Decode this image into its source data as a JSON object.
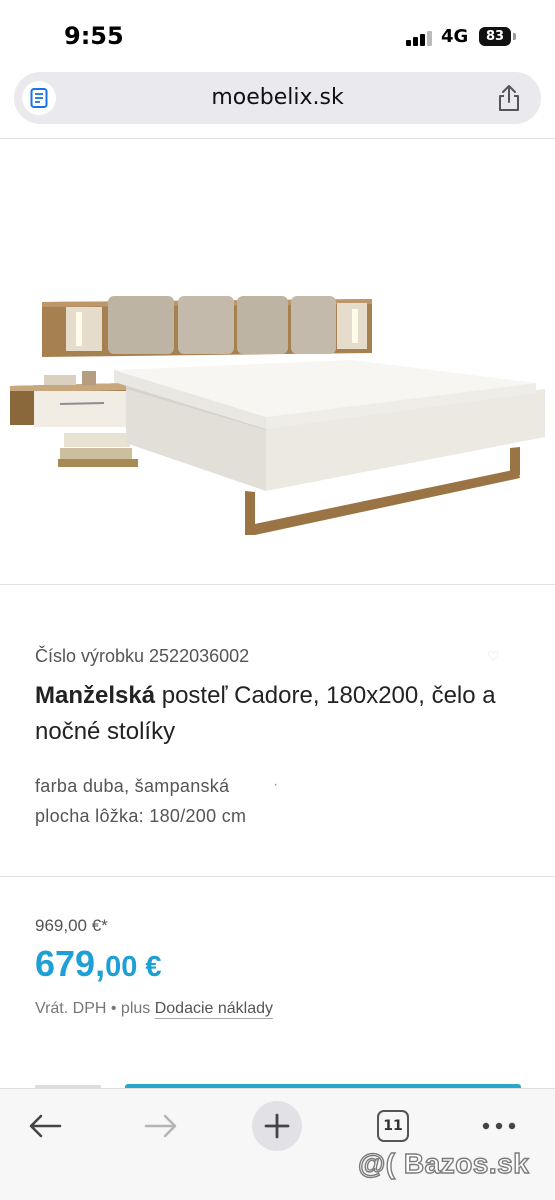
{
  "status_bar": {
    "time": "9:55",
    "network": "4G",
    "battery": "83"
  },
  "browser": {
    "url_host": "moebelix.sk",
    "open_tabs": "11"
  },
  "product": {
    "sku_label": "Číslo výrobku 2522036002",
    "title_bold": "Manželská",
    "title_rest": " posteľ Cadore, 180x200, čelo a nočné stolíky",
    "attributes": [
      "farba duba, šampanská",
      "plocha lôžka: 180/200 cm"
    ],
    "attribute_separator": "·"
  },
  "pricing": {
    "old_price": "969,00 €*",
    "price_main": "679,",
    "price_cents": "00 €",
    "vat_text": "Vrát. DPH • plus ",
    "shipping_link": "Dodacie náklady",
    "accent_color": "#1e9fd5"
  },
  "watermark": "@( Bazos.sk",
  "icons": {
    "reader": "reader-icon",
    "share": "share-icon",
    "back": "back-arrow-icon",
    "forward": "forward-arrow-icon",
    "new_tab": "plus-icon",
    "tabs": "tabs-icon",
    "more": "more-icon"
  }
}
